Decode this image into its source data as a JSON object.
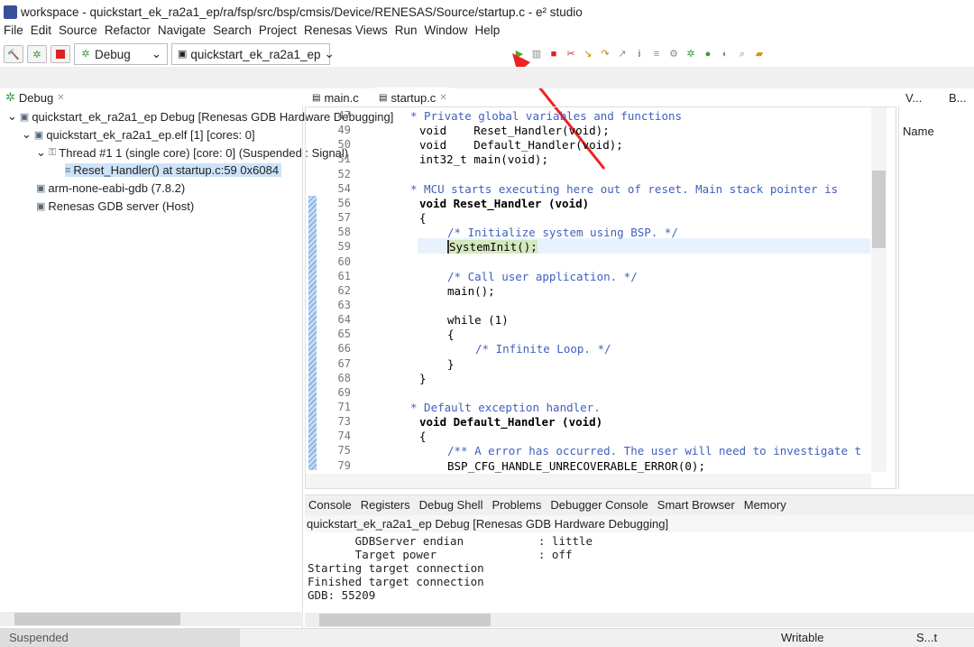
{
  "window_title": "workspace - quickstart_ek_ra2a1_ep/ra/fsp/src/bsp/cmsis/Device/RENESAS/Source/startup.c - e² studio",
  "menu": [
    "File",
    "Edit",
    "Source",
    "Refactor",
    "Navigate",
    "Search",
    "Project",
    "Renesas Views",
    "Run",
    "Window",
    "Help"
  ],
  "toolbar": {
    "launch_mode": "Debug",
    "launch_config": "quickstart_ek_ra2a1_ep",
    "resume_color": "#5aa02c"
  },
  "debug_view": {
    "tab": "Debug",
    "items": [
      {
        "label": "quickstart_ek_ra2a1_ep Debug [Renesas GDB Hardware Debugging]"
      },
      {
        "label": "quickstart_ek_ra2a1_ep.elf [1] [cores: 0]"
      },
      {
        "label": "Thread #1 1 (single core) [core: 0] (Suspended : Signal)"
      },
      {
        "label": "Reset_Handler() at startup.c:59 0x6084"
      },
      {
        "label": "arm-none-eabi-gdb (7.8.2)"
      },
      {
        "label": "Renesas GDB server (Host)"
      }
    ]
  },
  "editor": {
    "tabs": [
      "main.c",
      "startup.c"
    ],
    "active_tab": "startup.c",
    "current_line": "59",
    "lines": [
      {
        "n": "47",
        "t": "* Private global variables and functions",
        "c": "cm",
        "i": 0
      },
      {
        "n": "49",
        "t": "void    Reset_Handler(void);",
        "c": "",
        "i": 0
      },
      {
        "n": "50",
        "t": "void    Default_Handler(void);",
        "c": "",
        "i": 0
      },
      {
        "n": "51",
        "t": "int32_t main(void);",
        "c": "",
        "i": 0
      },
      {
        "n": "52",
        "t": "",
        "c": "",
        "i": 0
      },
      {
        "n": "54",
        "t": "* MCU starts executing here out of reset. Main stack pointer is",
        "c": "cm",
        "i": 0
      },
      {
        "n": "56",
        "t": "void Reset_Handler (void)",
        "c": "b",
        "i": 0
      },
      {
        "n": "57",
        "t": "{",
        "c": "",
        "i": 0
      },
      {
        "n": "58",
        "t": "/* Initialize system using BSP. */",
        "c": "cm",
        "i": 1
      },
      {
        "n": "59",
        "t": "SystemInit();",
        "c": "",
        "i": 1
      },
      {
        "n": "60",
        "t": "",
        "c": "",
        "i": 0
      },
      {
        "n": "61",
        "t": "/* Call user application. */",
        "c": "cm",
        "i": 1
      },
      {
        "n": "62",
        "t": "main();",
        "c": "",
        "i": 1
      },
      {
        "n": "63",
        "t": "",
        "c": "",
        "i": 0
      },
      {
        "n": "64",
        "t": "while (1)",
        "c": "",
        "i": 1
      },
      {
        "n": "65",
        "t": "{",
        "c": "",
        "i": 1
      },
      {
        "n": "66",
        "t": "/* Infinite Loop. */",
        "c": "cm",
        "i": 2
      },
      {
        "n": "67",
        "t": "}",
        "c": "",
        "i": 1
      },
      {
        "n": "68",
        "t": "}",
        "c": "",
        "i": 0
      },
      {
        "n": "69",
        "t": "",
        "c": "",
        "i": 0
      },
      {
        "n": "71",
        "t": "* Default exception handler.",
        "c": "cm",
        "i": 0
      },
      {
        "n": "73",
        "t": "void Default_Handler (void)",
        "c": "b",
        "i": 0
      },
      {
        "n": "74",
        "t": "{",
        "c": "",
        "i": 0
      },
      {
        "n": "75",
        "t": "/** A error has occurred. The user will need to investigate t",
        "c": "cm",
        "i": 1
      },
      {
        "n": "79",
        "t": "BSP_CFG_HANDLE_UNRECOVERABLE_ERROR(0);",
        "c": "",
        "i": 1
      }
    ]
  },
  "right_view": {
    "tabs": [
      "V...",
      "B..."
    ],
    "column": "Name"
  },
  "console": {
    "tabs": [
      "Console",
      "Registers",
      "Debug Shell",
      "Problems",
      "Debugger Console",
      "Smart Browser",
      "Memory"
    ],
    "session": "quickstart_ek_ra2a1_ep Debug [Renesas GDB Hardware Debugging]",
    "lines": [
      "       GDBServer endian           : little",
      "       Target power               : off",
      "Starting target connection",
      "Finished target connection",
      "GDB: 55209"
    ]
  },
  "status": {
    "state": "Suspended",
    "mode": "Writable",
    "insert": "S...t"
  }
}
